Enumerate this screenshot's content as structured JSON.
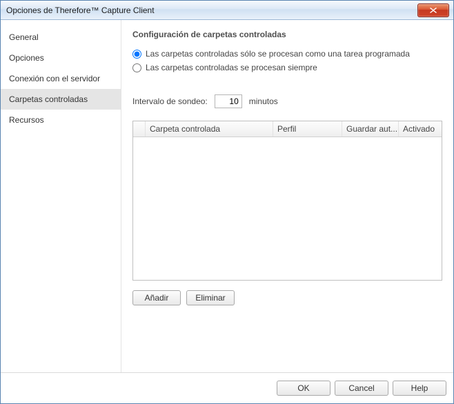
{
  "window": {
    "title": "Opciones de Therefore™ Capture Client"
  },
  "sidebar": {
    "items": [
      {
        "label": "General"
      },
      {
        "label": "Opciones"
      },
      {
        "label": "Conexión con el servidor"
      },
      {
        "label": "Carpetas controladas"
      },
      {
        "label": "Recursos"
      }
    ],
    "selected_index": 3
  },
  "content": {
    "section_header": "Configuración de carpetas controladas",
    "radio_scheduled": "Las carpetas controladas sólo se procesan como una tarea programada",
    "radio_always": "Las carpetas controladas se procesan siempre",
    "radio_selected": "scheduled",
    "interval_label": "Intervalo de sondeo:",
    "interval_value": "10",
    "interval_unit": "minutos",
    "table": {
      "columns": {
        "folder": "Carpeta controlada",
        "profile": "Perfil",
        "autosave": "Guardar aut...",
        "enabled": "Activado"
      }
    },
    "buttons": {
      "add": "Añadir",
      "remove": "Eliminar"
    }
  },
  "footer": {
    "ok": "OK",
    "cancel": "Cancel",
    "help": "Help"
  }
}
